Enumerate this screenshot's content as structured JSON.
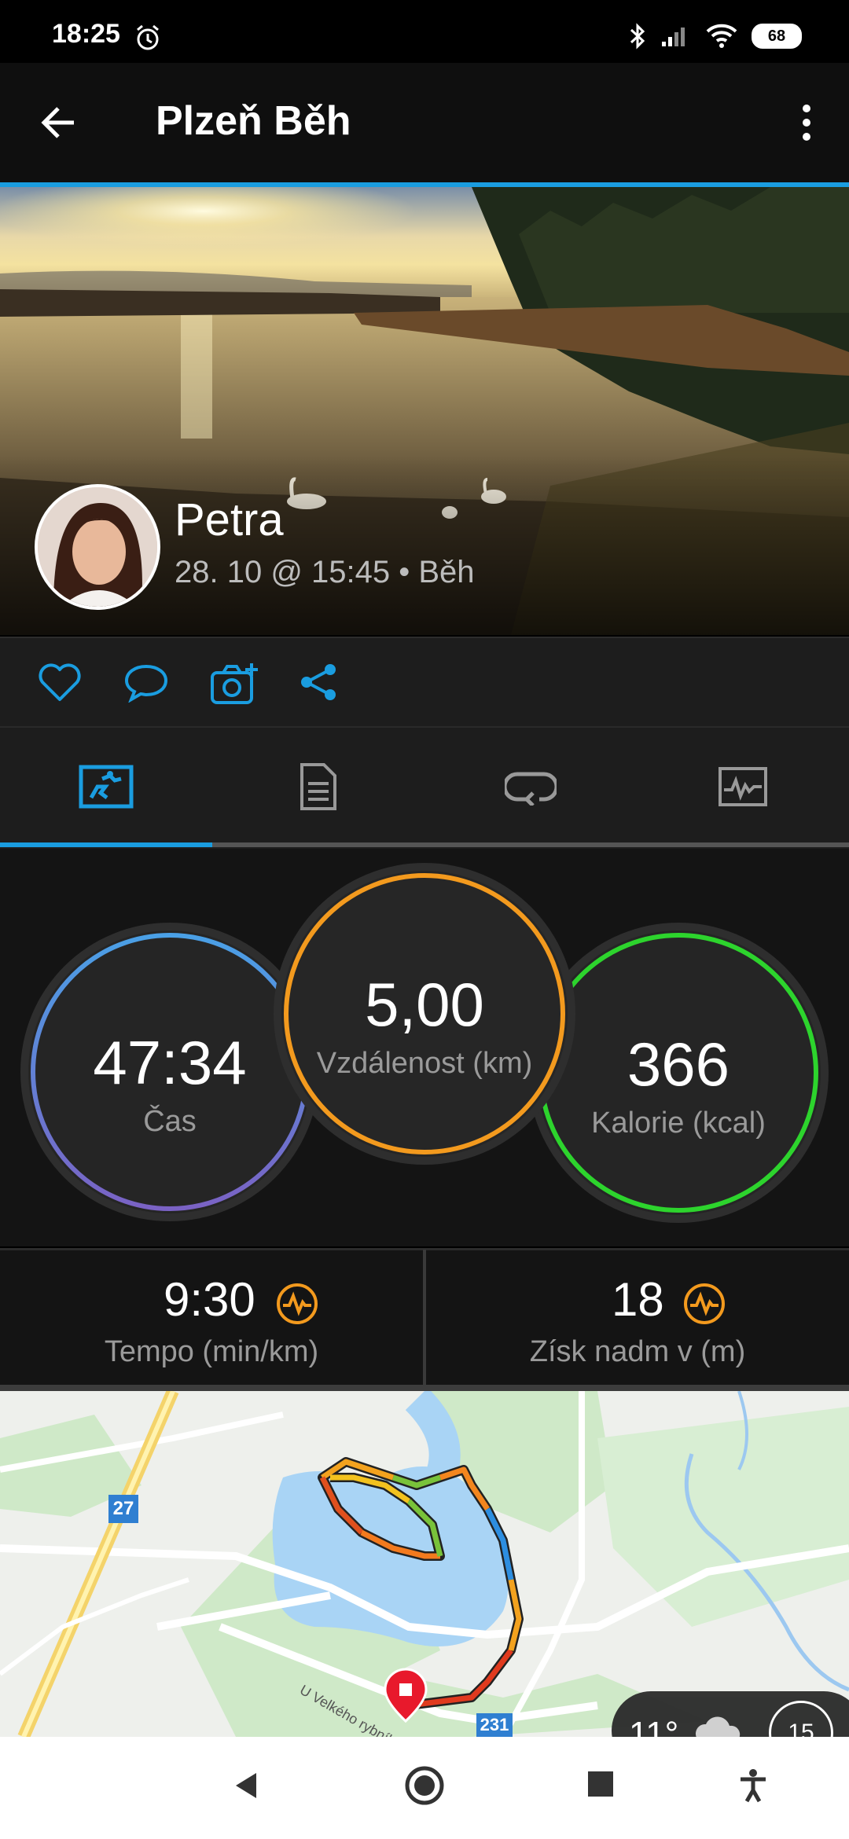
{
  "status_bar": {
    "time": "18:25",
    "battery": "68"
  },
  "app_bar": {
    "title": "Plzeň Běh"
  },
  "activity": {
    "user_name": "Petra",
    "meta": "28. 10 @ 15:45 • Běh"
  },
  "stats": {
    "time": {
      "value": "47:34",
      "label": "Čas"
    },
    "distance": {
      "value": "5,00",
      "label": "Vzdálenost (km)"
    },
    "calories": {
      "value": "366",
      "label": "Kalorie (kcal)"
    }
  },
  "metrics": {
    "pace": {
      "value": "9:30",
      "label": "Tempo (min/km)"
    },
    "elevation": {
      "value": "18",
      "label": "Získ nadm v (m)"
    }
  },
  "map": {
    "road_27": "27",
    "road_231": "231",
    "street": "U Velkého rybníka",
    "weather_temp": "11°",
    "weather_extra": "15"
  },
  "colors": {
    "accent": "#1a9de0",
    "time_ring": "#4aa0e6",
    "distance_ring": "#f39a1e",
    "calories_ring": "#2dd42d",
    "metric_icon": "#f39a1e"
  }
}
